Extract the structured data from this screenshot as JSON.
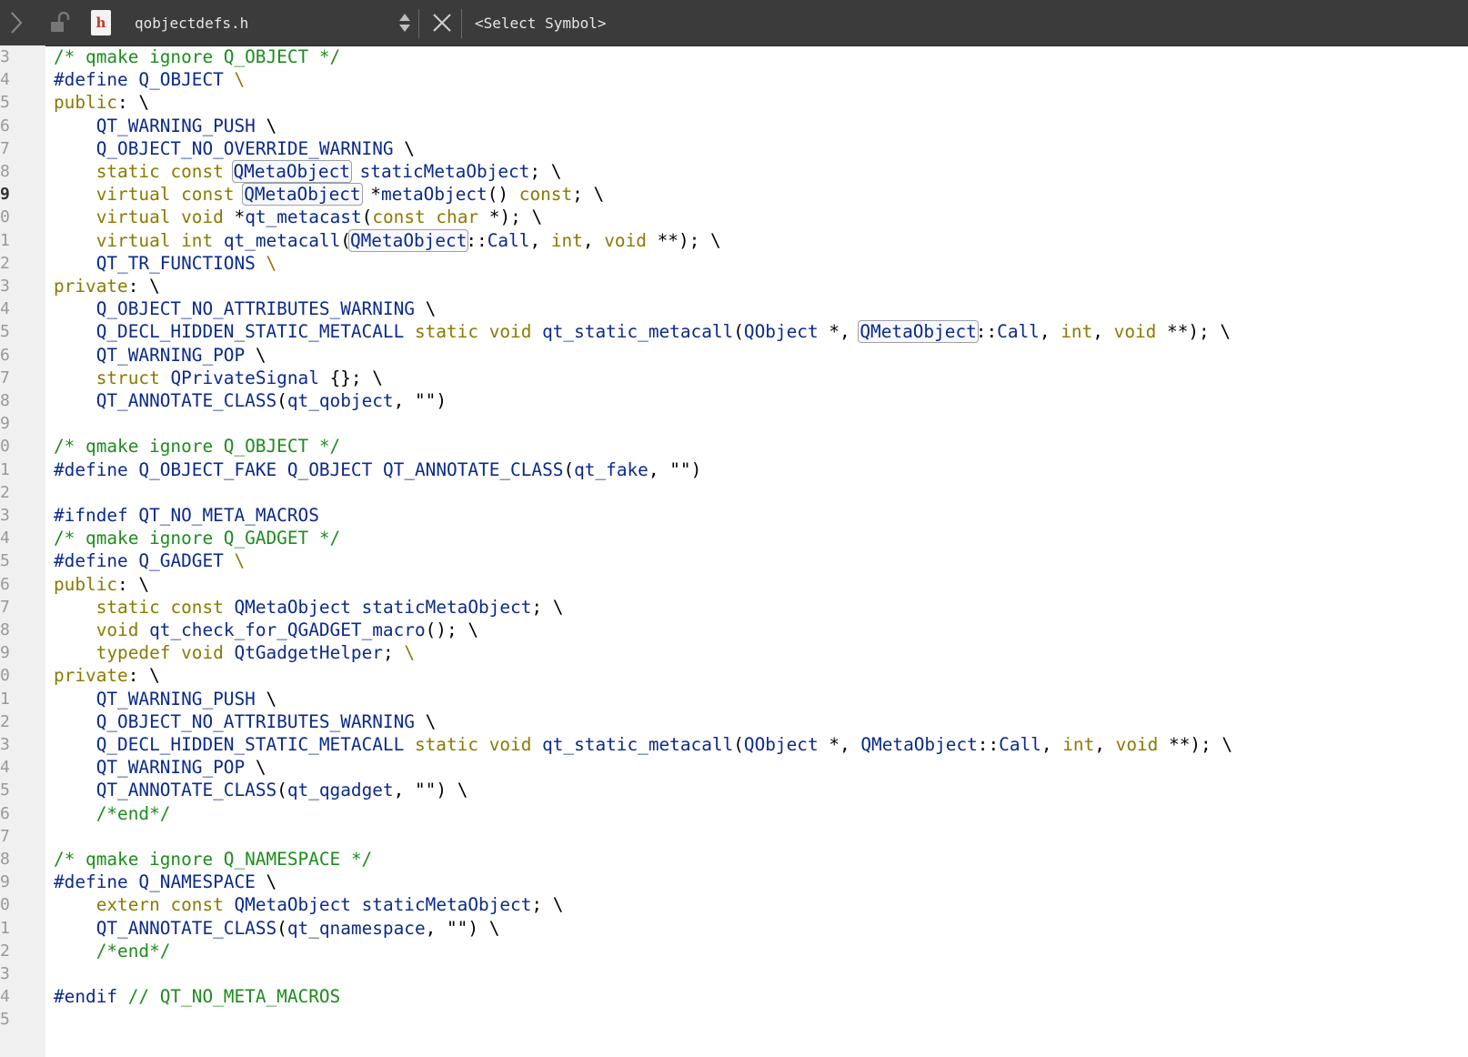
{
  "toolbar": {
    "file_name": "qobjectdefs.h",
    "symbol_select": "<Select Symbol>",
    "file_badge_letter": "h"
  },
  "editor": {
    "current_line": "9",
    "highlight_word": "QMetaObject",
    "line_numbers": [
      "3",
      "4",
      "5",
      "6",
      "7",
      "8",
      "9",
      "0",
      "1",
      "2",
      "3",
      "4",
      "5",
      "6",
      "7",
      "8",
      "9",
      "0",
      "1",
      "2",
      "3",
      "4",
      "5",
      "6",
      "7",
      "8",
      "9",
      "0",
      "1",
      "2",
      "3",
      "4",
      "5",
      "6",
      "7",
      "8",
      "9",
      "0",
      "1",
      "2",
      "3",
      "4",
      "5"
    ],
    "lines": [
      "/* qmake ignore Q_OBJECT */",
      "#define Q_OBJECT \\",
      "public: \\",
      "    QT_WARNING_PUSH \\",
      "    Q_OBJECT_NO_OVERRIDE_WARNING \\",
      "    static const QMetaObject staticMetaObject; \\",
      "    virtual const QMetaObject *metaObject() const; \\",
      "    virtual void *qt_metacast(const char *); \\",
      "    virtual int qt_metacall(QMetaObject::Call, int, void **); \\",
      "    QT_TR_FUNCTIONS \\",
      "private: \\",
      "    Q_OBJECT_NO_ATTRIBUTES_WARNING \\",
      "    Q_DECL_HIDDEN_STATIC_METACALL static void qt_static_metacall(QObject *, QMetaObject::Call, int, void **); \\",
      "    QT_WARNING_POP \\",
      "    struct QPrivateSignal {}; \\",
      "    QT_ANNOTATE_CLASS(qt_qobject, \"\")",
      "",
      "/* qmake ignore Q_OBJECT */",
      "#define Q_OBJECT_FAKE Q_OBJECT QT_ANNOTATE_CLASS(qt_fake, \"\")",
      "",
      "#ifndef QT_NO_META_MACROS",
      "/* qmake ignore Q_GADGET */",
      "#define Q_GADGET \\",
      "public: \\",
      "    static const QMetaObject staticMetaObject; \\",
      "    void qt_check_for_QGADGET_macro(); \\",
      "    typedef void QtGadgetHelper; \\",
      "private: \\",
      "    QT_WARNING_PUSH \\",
      "    Q_OBJECT_NO_ATTRIBUTES_WARNING \\",
      "    Q_DECL_HIDDEN_STATIC_METACALL static void qt_static_metacall(QObject *, QMetaObject::Call, int, void **); \\",
      "    QT_WARNING_POP \\",
      "    QT_ANNOTATE_CLASS(qt_qgadget, \"\") \\",
      "    /*end*/",
      "",
      "/* qmake ignore Q_NAMESPACE */",
      "#define Q_NAMESPACE \\",
      "    extern const QMetaObject staticMetaObject; \\",
      "    QT_ANNOTATE_CLASS(qt_qnamespace, \"\") \\",
      "    /*end*/",
      "",
      "#endif // QT_NO_META_MACROS",
      ""
    ]
  },
  "colors": {
    "toolbar_bg": "#3b3b3b",
    "gutter_bg": "#f0f0f0",
    "keyword": "#8a7a00",
    "comment": "#1d8c1d",
    "identifier": "#0b2a8a",
    "highlight_border": "#9ca0a8"
  }
}
